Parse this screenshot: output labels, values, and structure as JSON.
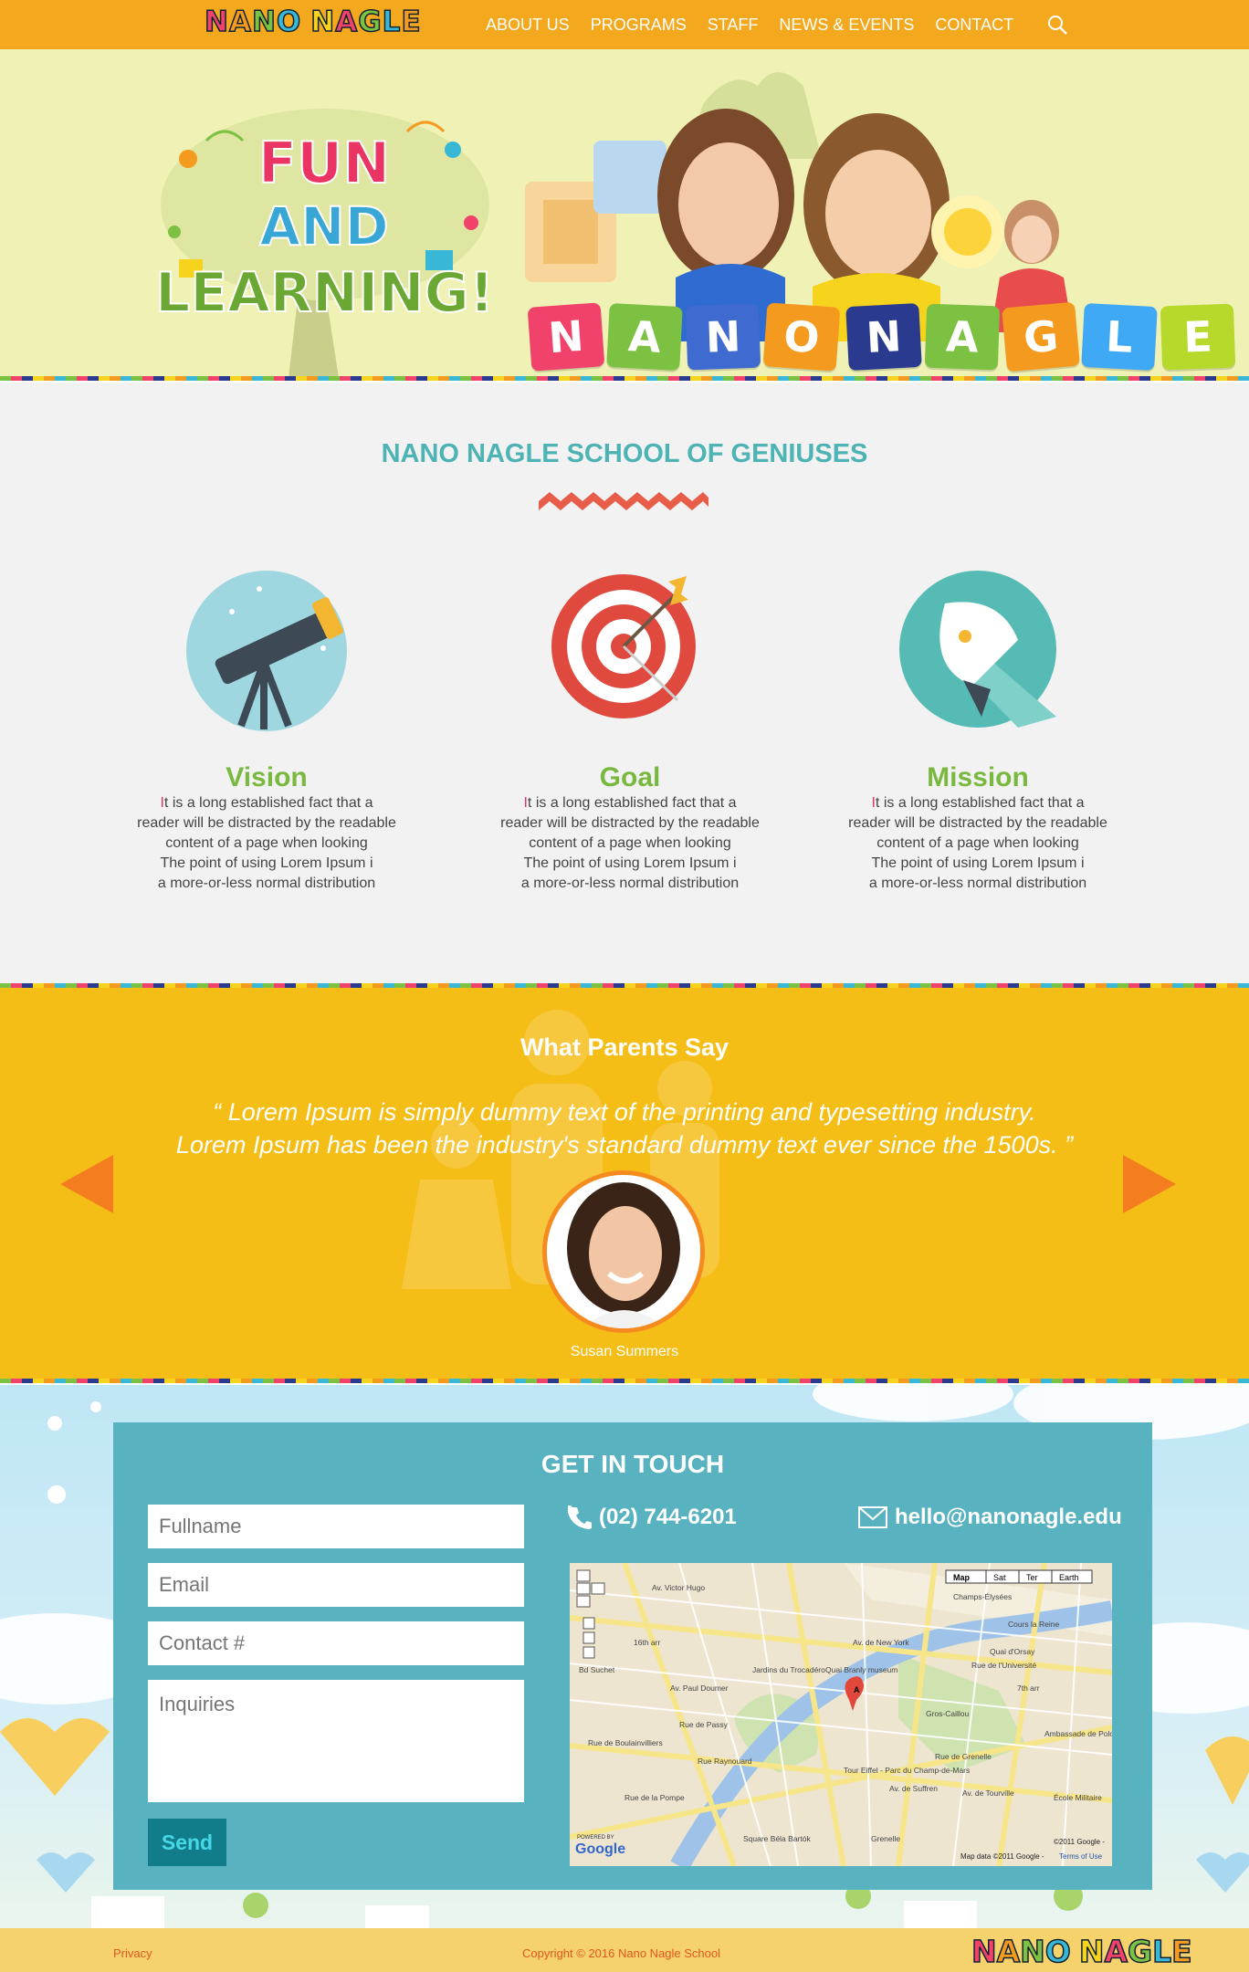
{
  "header": {
    "logo_letters": [
      "N",
      "A",
      "N",
      "O",
      " ",
      "N",
      "A",
      "G",
      "L",
      "E"
    ],
    "logo_colors": [
      "#f0426b",
      "#f39a1f",
      "#7cc142",
      "#38b8d6",
      "#fff",
      "#f6d31c",
      "#f0426b",
      "#7cc142",
      "#38b8d6",
      "#f39a1f"
    ],
    "nav": [
      "ABOUT US",
      "PROGRAMS",
      "STAFF",
      "NEWS & EVENTS",
      "CONTACT"
    ]
  },
  "hero": {
    "line1": "FUN",
    "line2": "AND",
    "line3": "LEARNING!",
    "blocks": [
      "N",
      "A",
      "N",
      "O",
      "N",
      "A",
      "G",
      "L",
      "E"
    ],
    "block_colors": [
      "#f0426b",
      "#7cc142",
      "#3f6bd0",
      "#f39a1f",
      "#2a3b8f",
      "#7cc142",
      "#f39a1f",
      "#3fa9f5",
      "#b7d92b"
    ]
  },
  "geniuses": {
    "title": "NANO NAGLE SCHOOL OF GENIUSES",
    "features": [
      {
        "title": "Vision",
        "first": "I",
        "lines": [
          "t is a long established fact that a",
          "reader will be distracted by the readable",
          "content of a page when looking",
          "The point of using Lorem Ipsum i",
          "a more-or-less normal distribution"
        ]
      },
      {
        "title": "Goal",
        "first": "I",
        "lines": [
          "t is a long established fact that a",
          "reader will be distracted by the readable",
          "content of a page when looking",
          "The point of using Lorem Ipsum i",
          "a more-or-less normal distribution"
        ]
      },
      {
        "title": "Mission",
        "first": "I",
        "lines": [
          "t is a long established fact that a",
          "reader will be distracted by the readable",
          "content of a page when looking",
          "The point of using Lorem Ipsum i",
          "a more-or-less normal distribution"
        ]
      }
    ]
  },
  "testimonials": {
    "title": "What Parents Say",
    "quote_line1": "“ Lorem Ipsum is simply dummy text of the printing and typesetting industry.",
    "quote_line2": "Lorem Ipsum has been the industry's standard dummy text ever since the 1500s. ”",
    "name": "Susan Summers"
  },
  "contact": {
    "title": "GET IN TOUCH",
    "fullname_placeholder": "Fullname",
    "email_placeholder": "Email",
    "contact_placeholder": "Contact #",
    "inquiries_placeholder": "Inquiries",
    "send_label": "Send",
    "phone": "(02) 744-6201",
    "email": "hello@nanonagle.edu",
    "map": {
      "tabs": [
        "Map",
        "Sat",
        "Ter",
        "Earth"
      ],
      "labels": [
        "Champs-Élysées",
        "16th arr",
        "Av. Victor Hugo",
        "Jardins du Trocadéro",
        "Quai Branly museum",
        "Rue de l'Université",
        "Gros-Caillou",
        "7th arr",
        "Tour Eiffel - Parc du Champ-de-Mars",
        "Av. de New York",
        "Cours la Reine",
        "Quai d'Orsay",
        "Rue de Passy",
        "Av. Paul Doumer",
        "Rue de Grenelle",
        "Grenelle",
        "Square Béla Bartók",
        "École Militaire",
        "Av. de Tourville",
        "Av. de Suffren",
        "Rue Raynouard",
        "Bd Suchet",
        "Rue de la Pompe",
        "Rue de Boulainvilliers",
        "Ambassade de Pologne"
      ],
      "pin": "A",
      "powered": "POWERED BY",
      "google": "Google",
      "copyright": "©2011 Google -",
      "data": "Map data ©2011 Google -",
      "terms": "Terms of Use"
    }
  },
  "footer": {
    "privacy": "Privacy",
    "copyright": "Copyright © 2016  Nano Nagle School"
  }
}
